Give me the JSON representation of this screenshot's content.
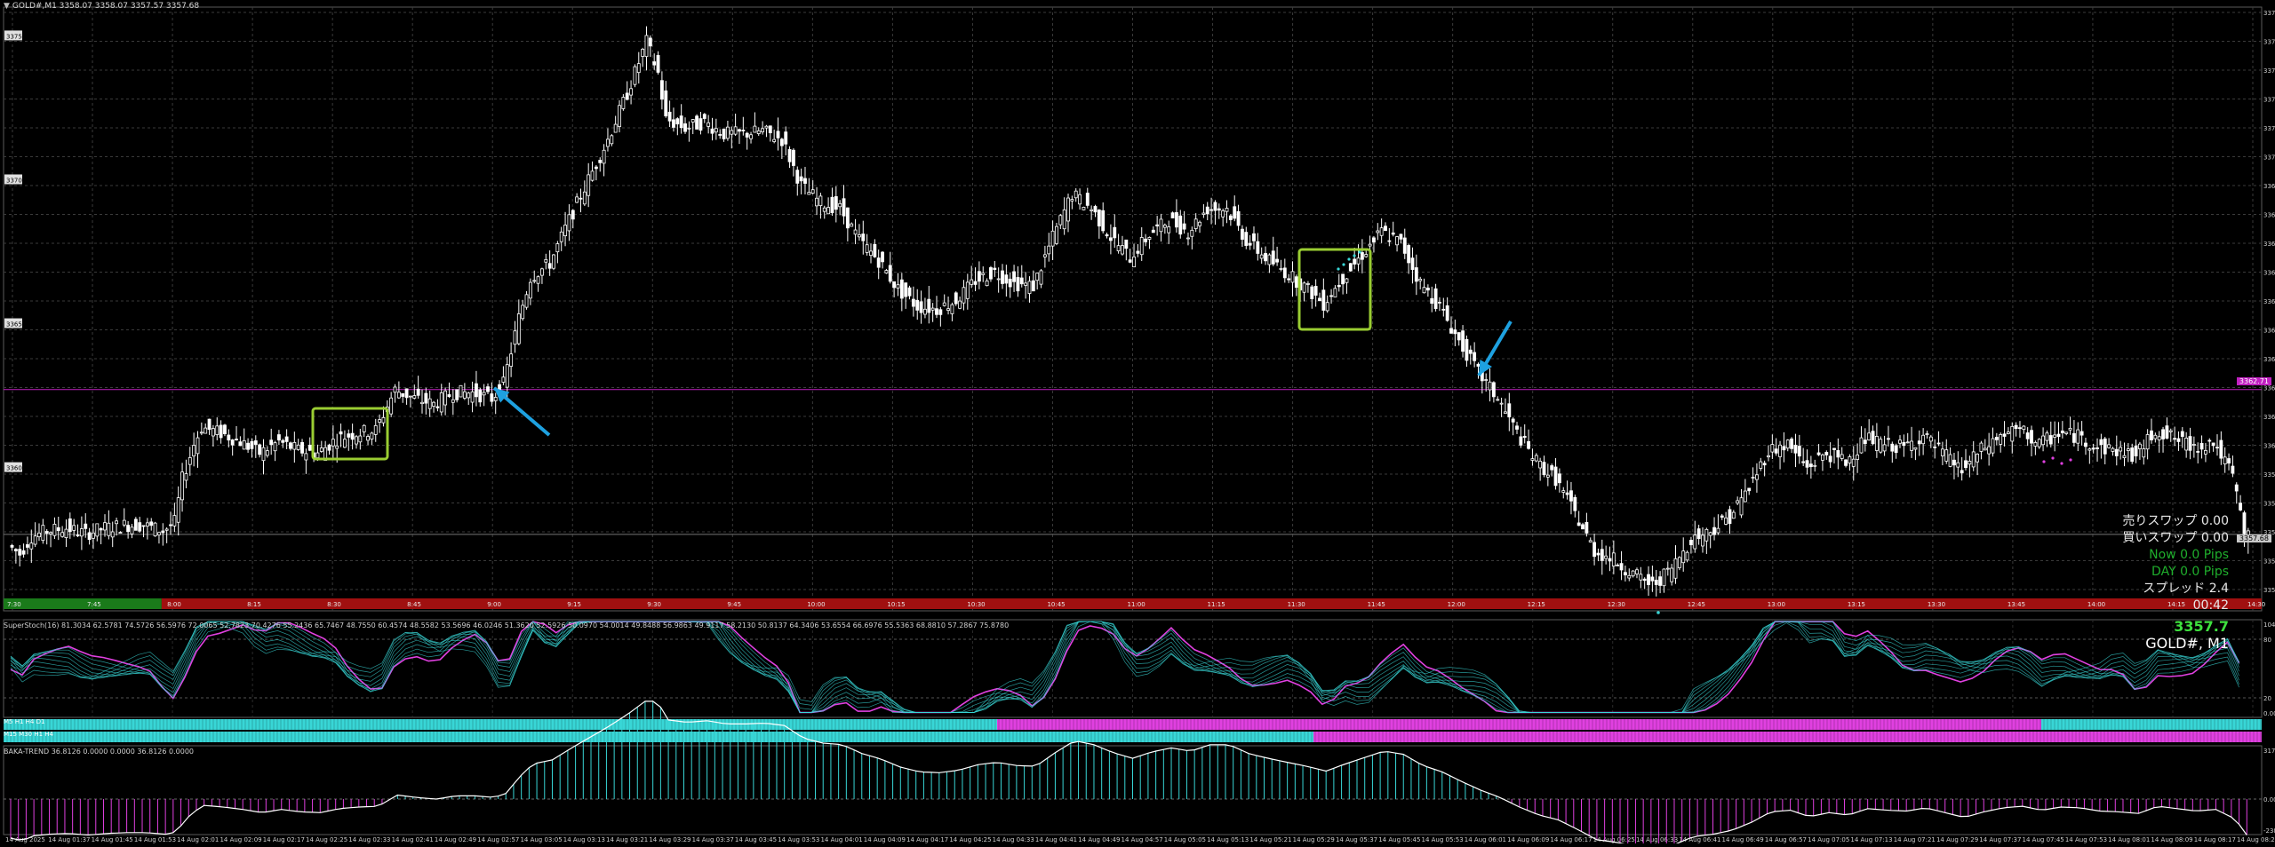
{
  "chart_info": {
    "symbol_line": "GOLD#,M1  3358.07 3358.07 3357.57 3357.68",
    "symbol_short": "GOLD#, M1"
  },
  "price_axis_labels": [
    "3376.00",
    "3374.05",
    "3373.00",
    "3371.95",
    "3370.90",
    "3370.00",
    "3369.05",
    "3368.00",
    "3367.15",
    "3366.10",
    "3365.05",
    "3364.00",
    "3363.35",
    "3362.50",
    "3361.40",
    "3360.45",
    "3359.50",
    "3358.70",
    "3357.60",
    "3356.45",
    "3355.70"
  ],
  "left_price_marks": [
    "3375",
    "3370",
    "3365",
    "3360"
  ],
  "current_price_tag": "3357.68",
  "hline_price_tag": "3362.71",
  "time_axis_labels": [
    "14 Aug 2025",
    "14 Aug 01:37",
    "14 Aug 01:45",
    "14 Aug 01:53",
    "14 Aug 02:01",
    "14 Aug 02:09",
    "14 Aug 02:17",
    "14 Aug 02:25",
    "14 Aug 02:33",
    "14 Aug 02:41",
    "14 Aug 02:49",
    "14 Aug 02:57",
    "14 Aug 03:05",
    "14 Aug 03:13",
    "14 Aug 03:21",
    "14 Aug 03:29",
    "14 Aug 03:37",
    "14 Aug 03:45",
    "14 Aug 03:53",
    "14 Aug 04:01",
    "14 Aug 04:09",
    "14 Aug 04:17",
    "14 Aug 04:25",
    "14 Aug 04:33",
    "14 Aug 04:41",
    "14 Aug 04:49",
    "14 Aug 04:57",
    "14 Aug 05:05",
    "14 Aug 05:13",
    "14 Aug 05:21",
    "14 Aug 05:29",
    "14 Aug 05:37",
    "14 Aug 05:45",
    "14 Aug 05:53",
    "14 Aug 06:01",
    "14 Aug 06:09",
    "14 Aug 06:17",
    "14 Aug 06:25",
    "14 Aug 06:33",
    "14 Aug 06:41",
    "14 Aug 06:49",
    "14 Aug 06:57",
    "14 Aug 07:05",
    "14 Aug 07:13",
    "14 Aug 07:21",
    "14 Aug 07:29",
    "14 Aug 07:37",
    "14 Aug 07:45",
    "14 Aug 07:53",
    "14 Aug 08:01",
    "14 Aug 08:09",
    "14 Aug 08:17",
    "14 Aug 08:25"
  ],
  "session_labels": [
    "7:30",
    "7:45",
    "8:00",
    "8:15",
    "8:30",
    "8:45",
    "9:00",
    "9:15",
    "9:30",
    "9:45",
    "10:00",
    "10:15",
    "10:30",
    "10:45",
    "11:00",
    "11:15",
    "11:30",
    "11:45",
    "12:00",
    "12:15",
    "12:30",
    "12:45",
    "13:00",
    "13:15",
    "13:30",
    "13:45",
    "14:00",
    "14:15",
    "14:30"
  ],
  "overlay": {
    "sell_swap": "売りスワップ 0.00",
    "buy_swap": "買いスワップ 0.00",
    "now": "Now   0.0 Pips",
    "day": "DAY   0.0 Pips",
    "spread": "スプレッド 2.4",
    "timer": "00:42",
    "price": "3357.7",
    "symbol": "GOLD#, M1"
  },
  "superstoch": {
    "title": "SuperStoch(16) 81.3034 62.5781 74.5726 56.5976 72.0065 52.7823 70.4276 55.2436 65.7467 48.7550 60.4574 48.5582 53.5696 46.0246 51.3620 52.5926 50.0970 54.0014 49.8488 56.9863 49.9117 58.2130 50.8137 64.3406 53.6554 66.6976 55.5363 68.8810 57.2867 75.8780",
    "axis_top": "104.9922",
    "axis_80": "80",
    "axis_20": "20",
    "axis_bottom": "0.0007"
  },
  "mtf_labels": [
    "M5 H1 H4 D1",
    "M15 M30 H1 H4"
  ],
  "baka": {
    "title": "BAKA-TREND 36.8126 0.0000 0.0000 36.8126 0.0000",
    "axis_top": "317.5905",
    "axis_zero": "0.00",
    "axis_bottom": "-238.3913"
  },
  "colors": {
    "bull": "#ffffff",
    "bear": "#ffffff",
    "grid": "#3a3a3a",
    "hline": "#c020c0",
    "box": "#9acd32",
    "arrow": "#1ea1e0",
    "cyan": "#38d6d6",
    "magenta": "#e040e0",
    "session_green": "#1a7a1a",
    "session_red": "#a01010"
  },
  "chart_data": {
    "type": "candlestick",
    "symbol": "GOLD#",
    "timeframe": "M1",
    "ylim": [
      3355.7,
      3376.0
    ],
    "close_path": [
      [
        0,
        3357.3
      ],
      [
        3,
        3357.0
      ],
      [
        6,
        3357.6
      ],
      [
        10,
        3357.8
      ],
      [
        15,
        3357.9
      ],
      [
        20,
        3357.7
      ],
      [
        25,
        3357.9
      ],
      [
        30,
        3358.0
      ],
      [
        35,
        3358.0
      ],
      [
        40,
        3357.8
      ],
      [
        43,
        3358.1
      ],
      [
        45,
        3359.6
      ],
      [
        48,
        3360.8
      ],
      [
        50,
        3361.4
      ],
      [
        55,
        3361.2
      ],
      [
        60,
        3360.9
      ],
      [
        65,
        3360.5
      ],
      [
        70,
        3360.9
      ],
      [
        75,
        3360.6
      ],
      [
        80,
        3360.5
      ],
      [
        85,
        3361.0
      ],
      [
        90,
        3361.2
      ],
      [
        95,
        3361.3
      ],
      [
        100,
        3362.7
      ],
      [
        105,
        3362.4
      ],
      [
        110,
        3362.2
      ],
      [
        115,
        3362.6
      ],
      [
        120,
        3362.6
      ],
      [
        125,
        3362.4
      ],
      [
        128,
        3362.9
      ],
      [
        132,
        3365.2
      ],
      [
        135,
        3366.6
      ],
      [
        140,
        3367.1
      ],
      [
        145,
        3368.6
      ],
      [
        150,
        3370.0
      ],
      [
        155,
        3371.4
      ],
      [
        160,
        3373.0
      ],
      [
        165,
        3374.8
      ],
      [
        168,
        3373.7
      ],
      [
        170,
        3372.1
      ],
      [
        175,
        3371.8
      ],
      [
        180,
        3372.0
      ],
      [
        185,
        3371.6
      ],
      [
        190,
        3371.6
      ],
      [
        195,
        3371.7
      ],
      [
        200,
        3371.4
      ],
      [
        205,
        3369.8
      ],
      [
        210,
        3369.2
      ],
      [
        215,
        3369.0
      ],
      [
        220,
        3367.9
      ],
      [
        225,
        3367.2
      ],
      [
        230,
        3366.2
      ],
      [
        235,
        3365.6
      ],
      [
        240,
        3365.5
      ],
      [
        245,
        3365.8
      ],
      [
        250,
        3366.5
      ],
      [
        255,
        3366.8
      ],
      [
        260,
        3366.4
      ],
      [
        265,
        3366.3
      ],
      [
        270,
        3368.0
      ],
      [
        275,
        3369.5
      ],
      [
        280,
        3369.0
      ],
      [
        285,
        3368.0
      ],
      [
        290,
        3367.3
      ],
      [
        295,
        3368.1
      ],
      [
        300,
        3368.6
      ],
      [
        305,
        3368.2
      ],
      [
        310,
        3369.0
      ],
      [
        315,
        3369.0
      ],
      [
        320,
        3367.9
      ],
      [
        325,
        3367.3
      ],
      [
        330,
        3366.8
      ],
      [
        335,
        3366.3
      ],
      [
        340,
        3365.7
      ],
      [
        345,
        3366.6
      ],
      [
        350,
        3367.4
      ],
      [
        355,
        3368.2
      ],
      [
        360,
        3367.8
      ],
      [
        365,
        3366.4
      ],
      [
        370,
        3365.6
      ],
      [
        375,
        3364.4
      ],
      [
        380,
        3363.3
      ],
      [
        385,
        3362.4
      ],
      [
        390,
        3361.2
      ],
      [
        395,
        3360.2
      ],
      [
        400,
        3359.6
      ],
      [
        405,
        3358.4
      ],
      [
        410,
        3357.1
      ],
      [
        415,
        3356.8
      ],
      [
        420,
        3356.3
      ],
      [
        425,
        3355.9
      ],
      [
        430,
        3356.5
      ],
      [
        435,
        3357.5
      ],
      [
        440,
        3357.8
      ],
      [
        445,
        3358.3
      ],
      [
        450,
        3359.3
      ],
      [
        455,
        3360.6
      ],
      [
        460,
        3360.8
      ],
      [
        465,
        3360.0
      ],
      [
        470,
        3360.5
      ],
      [
        475,
        3360.2
      ],
      [
        480,
        3361.0
      ],
      [
        485,
        3360.8
      ],
      [
        490,
        3360.7
      ],
      [
        495,
        3361.1
      ],
      [
        500,
        3360.5
      ],
      [
        505,
        3359.9
      ],
      [
        510,
        3360.6
      ],
      [
        515,
        3361.1
      ],
      [
        520,
        3361.3
      ],
      [
        525,
        3360.8
      ],
      [
        530,
        3361.2
      ],
      [
        535,
        3361.1
      ],
      [
        540,
        3360.7
      ],
      [
        545,
        3360.6
      ],
      [
        550,
        3360.4
      ],
      [
        555,
        3361.3
      ],
      [
        560,
        3361.0
      ],
      [
        565,
        3360.7
      ],
      [
        570,
        3360.9
      ],
      [
        575,
        3359.7
      ],
      [
        578,
        3357.7
      ]
    ]
  }
}
